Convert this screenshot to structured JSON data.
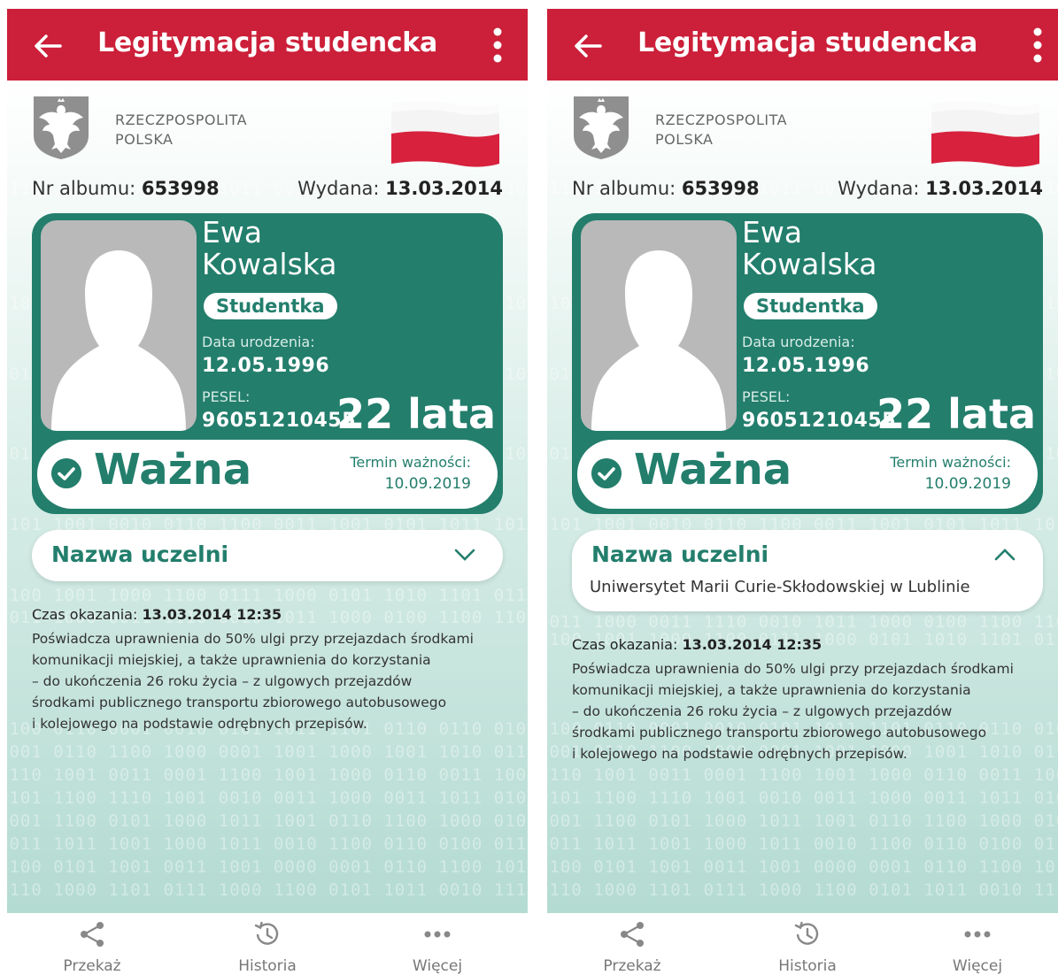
{
  "header": {
    "title": "Legitymacja studencka"
  },
  "emblem": {
    "line1": "RZECZPOSPOLITA",
    "line2": "POLSKA"
  },
  "id_meta": {
    "album_label": "Nr albumu:",
    "album_number": "653998",
    "issued_label": "Wydana:",
    "issued_date": "13.03.2014"
  },
  "person": {
    "first_name": "Ewa",
    "last_name": "Kowalska",
    "role": "Studentka",
    "birth_label": "Data urodzenia:",
    "birth_date": "12.05.1996",
    "pesel_label": "PESEL:",
    "pesel": "96051210455",
    "age": "22 lata"
  },
  "validity": {
    "status": "Ważna",
    "expiry_label": "Termin ważności:",
    "expiry_date": "10.09.2019"
  },
  "university": {
    "label": "Nazwa uczelni",
    "name": "Uniwersytet Marii Curie-Skłodowskiej w Lublinie"
  },
  "presentation": {
    "time_label": "Czas okazania:",
    "time_value": "13.03.2014 12:35"
  },
  "description": [
    "Poświadcza uprawnienia do 50% ulgi przy przejazdach środkami",
    "komunikacji miejskiej, a także uprawnienia do korzystania",
    "– do ukończenia 26 roku życia – z ulgowych przejazdów",
    "środkami publicznego transportu zbiorowego autobusowego",
    "i kolejowego na podstawie odrębnych przepisów."
  ],
  "bottom_nav": {
    "share": "Przekaż",
    "history": "Historia",
    "more": "Więcej"
  },
  "colors": {
    "header_red": "#cc1f39",
    "card_green": "#237e6c",
    "nav_gray": "#777777"
  },
  "icons": [
    "arrow-left-icon",
    "kebab-menu-icon",
    "polish-eagle-emblem",
    "polish-flag",
    "check-circle-icon",
    "chevron-down-icon",
    "chevron-up-icon",
    "share-icon",
    "history-icon",
    "more-dots-icon"
  ]
}
